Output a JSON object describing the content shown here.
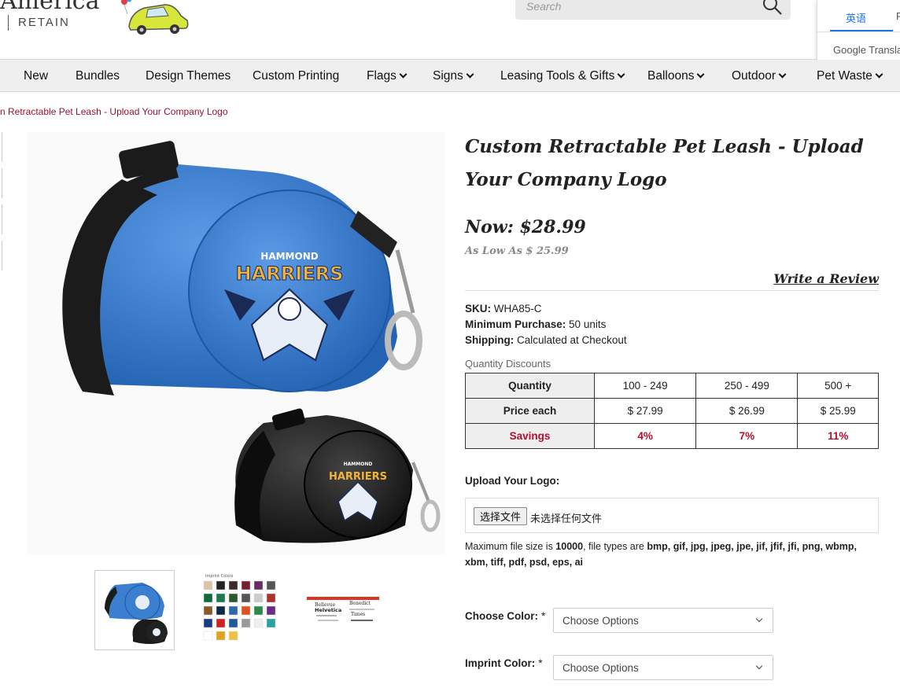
{
  "header": {
    "brand_partial": "America",
    "brand_sub": "RETAIN",
    "search_placeholder": "Search"
  },
  "translate": {
    "active_tab": "英语",
    "other_tab": "F",
    "brand": "Google Translate"
  },
  "nav": {
    "items": [
      {
        "label": "New",
        "dropdown": false
      },
      {
        "label": "Bundles",
        "dropdown": false
      },
      {
        "label": "Design Themes",
        "dropdown": false
      },
      {
        "label": "Custom Printing",
        "dropdown": false
      },
      {
        "label": "Flags",
        "dropdown": true
      },
      {
        "label": "Signs",
        "dropdown": true
      },
      {
        "label": "Leasing Tools & Gifts",
        "dropdown": true
      },
      {
        "label": "Balloons",
        "dropdown": true
      },
      {
        "label": "Outdoor",
        "dropdown": true
      },
      {
        "label": "Pet Waste",
        "dropdown": true
      }
    ]
  },
  "breadcrumb": "n Retractable Pet Leash - Upload Your Company Logo",
  "product": {
    "title": "Custom Retractable Pet Leash - Upload Your Company Logo",
    "price_now": "Now: $28.99",
    "price_low": "As Low As $ 25.99",
    "review_link": "Write a Review",
    "image_logo_text_top": "HAMMOND",
    "image_logo_text_main": "HARRIERS",
    "swatch_label": "Imprint Colors",
    "font_sample_names": [
      "Bellevue",
      "Benedict",
      "Helvetica",
      "Times"
    ],
    "specs": [
      {
        "label": "SKU:",
        "value": "WHA85-C"
      },
      {
        "label": "Minimum Purchase:",
        "value": "50 units"
      },
      {
        "label": "Shipping:",
        "value": "Calculated at Checkout"
      }
    ],
    "discounts_label": "Quantity Discounts",
    "discount_table": {
      "headers": [
        "Quantity",
        "100 - 249",
        "250 - 499",
        "500 +"
      ],
      "price_row": [
        "Price each",
        "$ 27.99",
        "$ 26.99",
        "$ 25.99"
      ],
      "savings_row": [
        "Savings",
        "4%",
        "7%",
        "11%"
      ]
    },
    "upload_label": "Upload Your Logo:",
    "file_button": "选择文件",
    "file_status": "未选择任何文件",
    "file_note_parts": [
      "Maximum file size is ",
      "10000",
      ", file types are ",
      "bmp, gif, jpg, jpeg, jpe, jif, jfif, jfi, png, wbmp, xbm, tiff, pdf, psd, eps, ai"
    ],
    "options": [
      {
        "label": "Choose Color:",
        "required": "*",
        "value": "Choose Options"
      },
      {
        "label": "Imprint Color:",
        "required": "*",
        "value": "Choose Options"
      }
    ]
  },
  "colors": {
    "accent_red": "#b0102e",
    "leash_blue": "#3a7fd0",
    "nav_bg": "#efefef"
  }
}
